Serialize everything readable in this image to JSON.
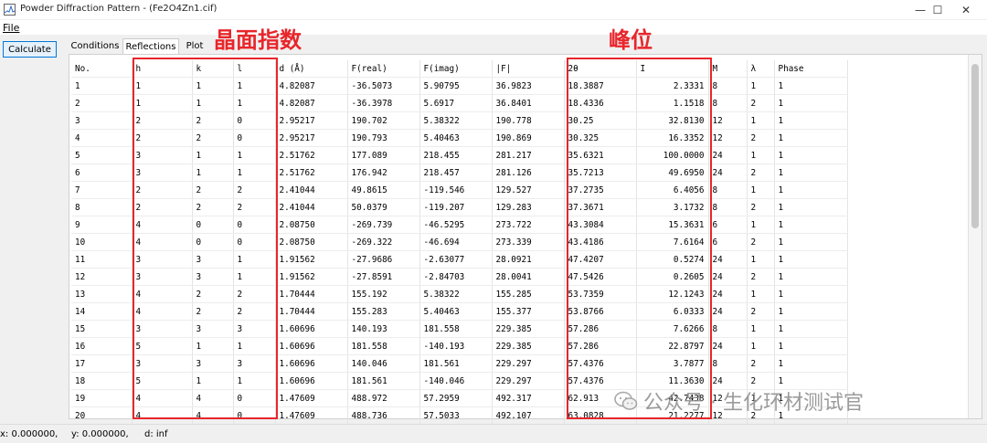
{
  "window": {
    "title": "Powder Diffraction Pattern - (Fe2O4Zn1.cif)",
    "minimize_glyph": "—",
    "maximize_glyph": "☐",
    "close_glyph": "✕"
  },
  "menu": {
    "file_label": "File"
  },
  "toolbar": {
    "calculate_label": "Calculate"
  },
  "tabs": [
    {
      "label": "Conditions",
      "active": false
    },
    {
      "label": "Reflections",
      "active": true
    },
    {
      "label": "Plot",
      "active": false
    }
  ],
  "annotations": {
    "plane_index_label": "晶面指数",
    "peak_position_label": "峰位"
  },
  "table": {
    "headers": [
      "No.",
      "h",
      "k",
      "l",
      "d (Å)",
      "F(real)",
      "F(imag)",
      "|F|",
      "2θ",
      "I",
      "M",
      "λ",
      "Phase"
    ],
    "rows": [
      [
        "1",
        "1",
        "1",
        "1",
        "4.82087",
        "-36.5073",
        "5.90795",
        "36.9823",
        "18.3887",
        "2.3331",
        "8",
        "1",
        "1"
      ],
      [
        "2",
        "1",
        "1",
        "1",
        "4.82087",
        "-36.3978",
        "5.6917",
        "36.8401",
        "18.4336",
        "1.1518",
        "8",
        "2",
        "1"
      ],
      [
        "3",
        "2",
        "2",
        "0",
        "2.95217",
        "190.702",
        "5.38322",
        "190.778",
        "30.25",
        "32.8130",
        "12",
        "1",
        "1"
      ],
      [
        "4",
        "2",
        "2",
        "0",
        "2.95217",
        "190.793",
        "5.40463",
        "190.869",
        "30.325",
        "16.3352",
        "12",
        "2",
        "1"
      ],
      [
        "5",
        "3",
        "1",
        "1",
        "2.51762",
        "177.089",
        "218.455",
        "281.217",
        "35.6321",
        "100.0000",
        "24",
        "1",
        "1"
      ],
      [
        "6",
        "3",
        "1",
        "1",
        "2.51762",
        "176.942",
        "218.457",
        "281.126",
        "35.7213",
        "49.6950",
        "24",
        "2",
        "1"
      ],
      [
        "7",
        "2",
        "2",
        "2",
        "2.41044",
        "49.8615",
        "-119.546",
        "129.527",
        "37.2735",
        "6.4056",
        "8",
        "1",
        "1"
      ],
      [
        "8",
        "2",
        "2",
        "2",
        "2.41044",
        "50.0379",
        "-119.207",
        "129.283",
        "37.3671",
        "3.1732",
        "8",
        "2",
        "1"
      ],
      [
        "9",
        "4",
        "0",
        "0",
        "2.08750",
        "-269.739",
        "-46.5295",
        "273.722",
        "43.3084",
        "15.3631",
        "6",
        "1",
        "1"
      ],
      [
        "10",
        "4",
        "0",
        "0",
        "2.08750",
        "-269.322",
        "-46.694",
        "273.339",
        "43.4186",
        "7.6164",
        "6",
        "2",
        "1"
      ],
      [
        "11",
        "3",
        "3",
        "1",
        "1.91562",
        "-27.9686",
        "-2.63077",
        "28.0921",
        "47.4207",
        "0.5274",
        "24",
        "1",
        "1"
      ],
      [
        "12",
        "3",
        "3",
        "1",
        "1.91562",
        "-27.8591",
        "-2.84703",
        "28.0041",
        "47.5426",
        "0.2605",
        "24",
        "2",
        "1"
      ],
      [
        "13",
        "4",
        "2",
        "2",
        "1.70444",
        "155.192",
        "5.38322",
        "155.285",
        "53.7359",
        "12.1243",
        "24",
        "1",
        "1"
      ],
      [
        "14",
        "4",
        "2",
        "2",
        "1.70444",
        "155.283",
        "5.40463",
        "155.377",
        "53.8766",
        "6.0333",
        "24",
        "2",
        "1"
      ],
      [
        "15",
        "3",
        "3",
        "3",
        "1.60696",
        "140.193",
        "181.558",
        "229.385",
        "57.286",
        "7.6266",
        "8",
        "1",
        "1"
      ],
      [
        "16",
        "5",
        "1",
        "1",
        "1.60696",
        "181.558",
        "-140.193",
        "229.385",
        "57.286",
        "22.8797",
        "24",
        "1",
        "1"
      ],
      [
        "17",
        "3",
        "3",
        "3",
        "1.60696",
        "140.046",
        "181.561",
        "229.297",
        "57.4376",
        "3.7877",
        "8",
        "2",
        "1"
      ],
      [
        "18",
        "5",
        "1",
        "1",
        "1.60696",
        "181.561",
        "-140.046",
        "229.297",
        "57.4376",
        "11.3630",
        "24",
        "2",
        "1"
      ],
      [
        "19",
        "4",
        "4",
        "0",
        "1.47609",
        "488.972",
        "57.2959",
        "492.317",
        "62.913",
        "42.7438",
        "12",
        "1",
        "1"
      ],
      [
        "20",
        "4",
        "4",
        "0",
        "1.47609",
        "488.736",
        "57.5033",
        "492.107",
        "63.0828",
        "21.2277",
        "12",
        "2",
        "1"
      ]
    ]
  },
  "status": {
    "x": "x: 0.000000,",
    "y": "y: 0.000000,",
    "d": "d: inf"
  },
  "watermark": {
    "text": "公众号 · 生化环材测试官"
  },
  "colors": {
    "highlight": "#e8262b",
    "accent": "#0078d7"
  }
}
